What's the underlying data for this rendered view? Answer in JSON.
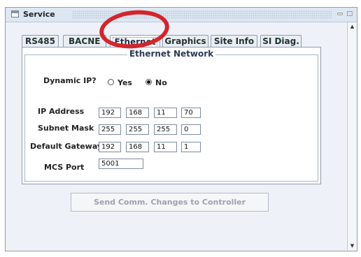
{
  "window": {
    "title": "Service"
  },
  "tabs": [
    {
      "label": "RS485",
      "active": false
    },
    {
      "label": "BACNE",
      "active": false
    },
    {
      "label": "Ethernet",
      "active": true
    },
    {
      "label": "Graphics",
      "active": false
    },
    {
      "label": "Site Info",
      "active": false
    },
    {
      "label": "SI Diag.",
      "active": false
    }
  ],
  "group": {
    "title": "Ethernet Network"
  },
  "dynamic_ip": {
    "label": "Dynamic IP?",
    "yes_label": "Yes",
    "no_label": "No",
    "selected": "No"
  },
  "fields": {
    "ip_address": {
      "label": "IP Address",
      "octets": [
        "192",
        "168",
        "11",
        "70"
      ]
    },
    "subnet_mask": {
      "label": "Subnet Mask",
      "octets": [
        "255",
        "255",
        "255",
        "0"
      ]
    },
    "default_gateway": {
      "label": "Default Gateway",
      "octets": [
        "192",
        "168",
        "11",
        "1"
      ]
    },
    "mcs_port": {
      "label": "MCS Port",
      "value": "5001"
    }
  },
  "send_button": {
    "label": "Send Comm. Changes to Controller",
    "enabled": false
  },
  "annotation": {
    "color": "#d3262b"
  }
}
